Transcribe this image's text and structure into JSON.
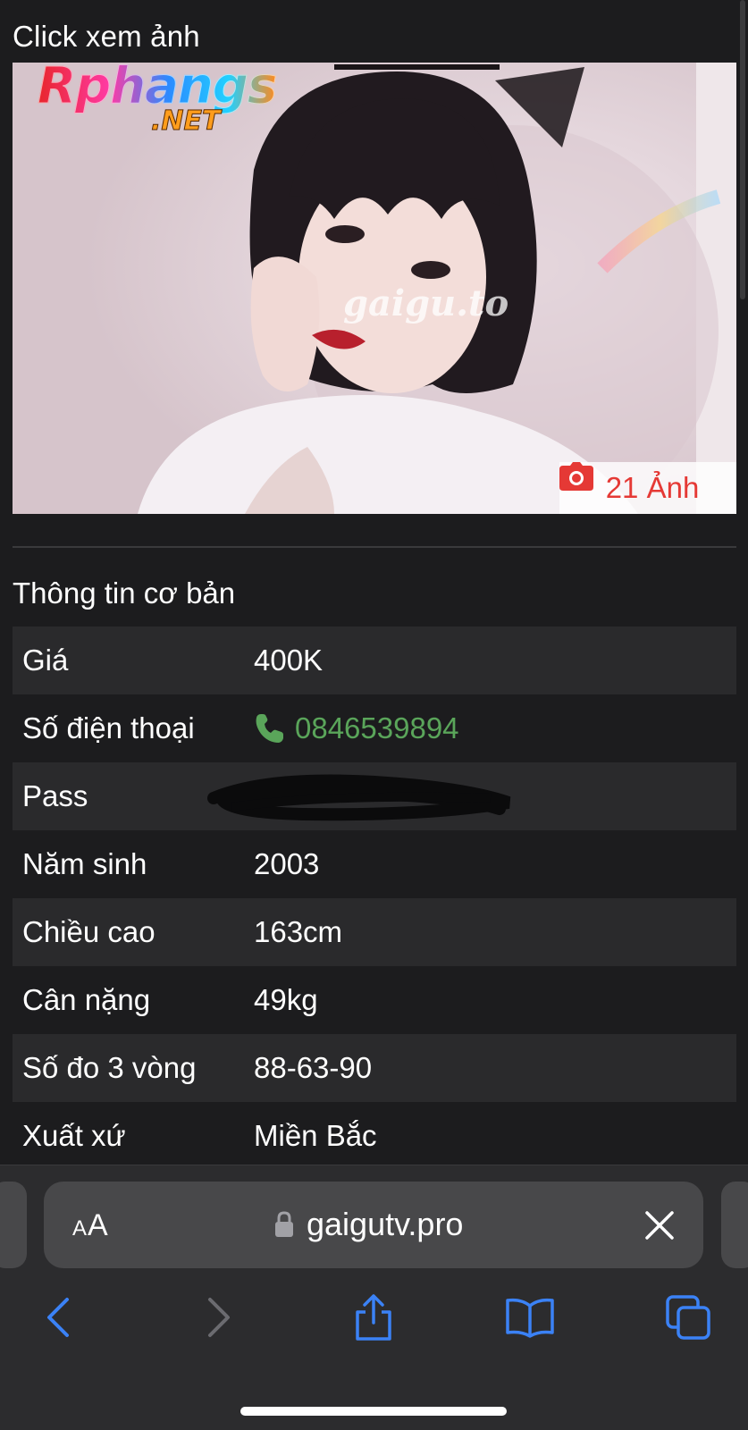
{
  "page": {
    "click_label": "Click xem ảnh"
  },
  "photo": {
    "logo_text": "Rphangs",
    "logo_suffix": ".NET",
    "watermark": "gaigu.to",
    "count_label": "21 Ảnh",
    "count_icon": "camera-icon"
  },
  "basic_info": {
    "title": "Thông tin cơ bản",
    "rows": [
      {
        "label": "Giá",
        "value": "400K"
      },
      {
        "label": "Số điện thoại",
        "value": "0846539894",
        "icon": "phone-icon"
      },
      {
        "label": "Pass",
        "value": ""
      },
      {
        "label": "Năm sinh",
        "value": "2003"
      },
      {
        "label": "Chiều cao",
        "value": "163cm"
      },
      {
        "label": "Cân nặng",
        "value": "49kg"
      },
      {
        "label": "Số đo 3 vòng",
        "value": "88-63-90"
      },
      {
        "label": "Xuất xứ",
        "value": "Miền Bắc"
      }
    ]
  },
  "browser": {
    "aa_small": "A",
    "aa_large": "A",
    "url": "gaigutv.pro",
    "lock_icon": "lock-icon",
    "toolbar": [
      "back-icon",
      "forward-icon",
      "share-icon",
      "bookmarks-icon",
      "tabs-icon"
    ]
  },
  "colors": {
    "background": "#1c1c1e",
    "row_shade": "#2a2a2c",
    "phone_green": "#5aa55a",
    "count_red": "#e53935",
    "toolbar_blue": "#3b82f6",
    "toolbar_disabled": "#6b6b70"
  }
}
